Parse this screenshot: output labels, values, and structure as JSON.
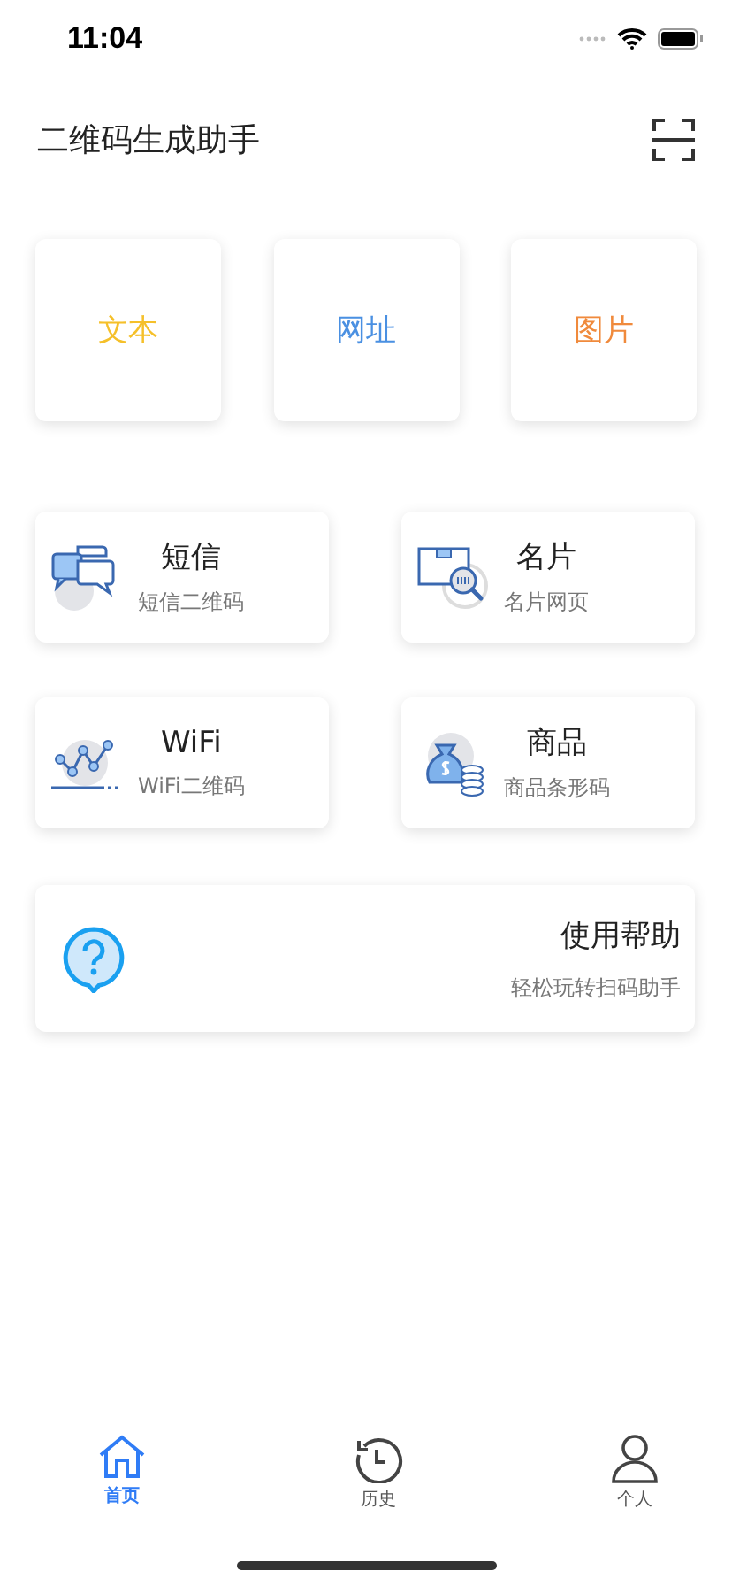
{
  "status_bar": {
    "time": "11:04"
  },
  "header": {
    "title": "二维码生成助手"
  },
  "quick_types": [
    {
      "label": "文本",
      "color": "#f5c02a"
    },
    {
      "label": "网址",
      "color": "#4a90e2"
    },
    {
      "label": "图片",
      "color": "#f08a3c"
    }
  ],
  "features": [
    {
      "kind": "message",
      "title": "短信",
      "subtitle": "短信二维码"
    },
    {
      "kind": "card",
      "title": "名片",
      "subtitle": "名片网页"
    },
    {
      "kind": "chart",
      "title": "WiFi",
      "subtitle": "WiFi二维码"
    },
    {
      "kind": "money",
      "title": "商品",
      "subtitle": "商品条形码"
    }
  ],
  "help": {
    "title": "使用帮助",
    "subtitle": "轻松玩转扫码助手"
  },
  "tab_bar": [
    {
      "kind": "home",
      "label": "首页",
      "selected": true
    },
    {
      "kind": "history",
      "label": "历史",
      "selected": false
    },
    {
      "kind": "person",
      "label": "个人",
      "selected": false
    }
  ]
}
